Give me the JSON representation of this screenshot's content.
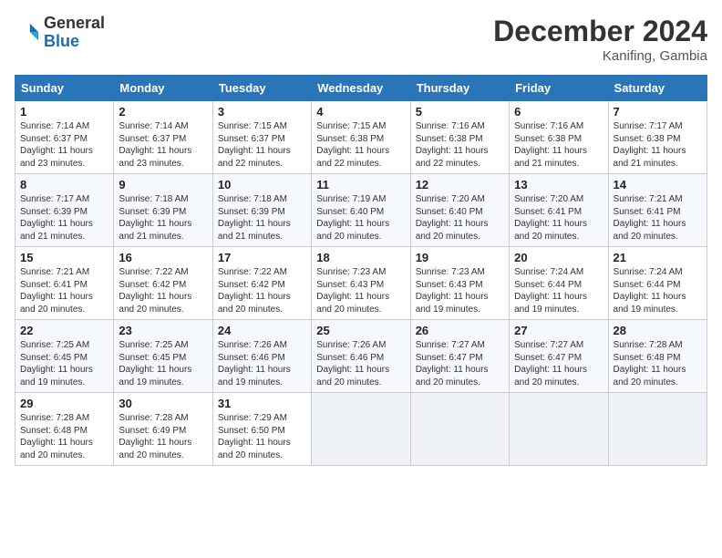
{
  "logo": {
    "general": "General",
    "blue": "Blue"
  },
  "title": "December 2024",
  "location": "Kanifing, Gambia",
  "days_of_week": [
    "Sunday",
    "Monday",
    "Tuesday",
    "Wednesday",
    "Thursday",
    "Friday",
    "Saturday"
  ],
  "weeks": [
    [
      {
        "day": 1,
        "info": "Sunrise: 7:14 AM\nSunset: 6:37 PM\nDaylight: 11 hours\nand 23 minutes."
      },
      {
        "day": 2,
        "info": "Sunrise: 7:14 AM\nSunset: 6:37 PM\nDaylight: 11 hours\nand 23 minutes."
      },
      {
        "day": 3,
        "info": "Sunrise: 7:15 AM\nSunset: 6:37 PM\nDaylight: 11 hours\nand 22 minutes."
      },
      {
        "day": 4,
        "info": "Sunrise: 7:15 AM\nSunset: 6:38 PM\nDaylight: 11 hours\nand 22 minutes."
      },
      {
        "day": 5,
        "info": "Sunrise: 7:16 AM\nSunset: 6:38 PM\nDaylight: 11 hours\nand 22 minutes."
      },
      {
        "day": 6,
        "info": "Sunrise: 7:16 AM\nSunset: 6:38 PM\nDaylight: 11 hours\nand 21 minutes."
      },
      {
        "day": 7,
        "info": "Sunrise: 7:17 AM\nSunset: 6:38 PM\nDaylight: 11 hours\nand 21 minutes."
      }
    ],
    [
      {
        "day": 8,
        "info": "Sunrise: 7:17 AM\nSunset: 6:39 PM\nDaylight: 11 hours\nand 21 minutes."
      },
      {
        "day": 9,
        "info": "Sunrise: 7:18 AM\nSunset: 6:39 PM\nDaylight: 11 hours\nand 21 minutes."
      },
      {
        "day": 10,
        "info": "Sunrise: 7:18 AM\nSunset: 6:39 PM\nDaylight: 11 hours\nand 21 minutes."
      },
      {
        "day": 11,
        "info": "Sunrise: 7:19 AM\nSunset: 6:40 PM\nDaylight: 11 hours\nand 20 minutes."
      },
      {
        "day": 12,
        "info": "Sunrise: 7:20 AM\nSunset: 6:40 PM\nDaylight: 11 hours\nand 20 minutes."
      },
      {
        "day": 13,
        "info": "Sunrise: 7:20 AM\nSunset: 6:41 PM\nDaylight: 11 hours\nand 20 minutes."
      },
      {
        "day": 14,
        "info": "Sunrise: 7:21 AM\nSunset: 6:41 PM\nDaylight: 11 hours\nand 20 minutes."
      }
    ],
    [
      {
        "day": 15,
        "info": "Sunrise: 7:21 AM\nSunset: 6:41 PM\nDaylight: 11 hours\nand 20 minutes."
      },
      {
        "day": 16,
        "info": "Sunrise: 7:22 AM\nSunset: 6:42 PM\nDaylight: 11 hours\nand 20 minutes."
      },
      {
        "day": 17,
        "info": "Sunrise: 7:22 AM\nSunset: 6:42 PM\nDaylight: 11 hours\nand 20 minutes."
      },
      {
        "day": 18,
        "info": "Sunrise: 7:23 AM\nSunset: 6:43 PM\nDaylight: 11 hours\nand 20 minutes."
      },
      {
        "day": 19,
        "info": "Sunrise: 7:23 AM\nSunset: 6:43 PM\nDaylight: 11 hours\nand 19 minutes."
      },
      {
        "day": 20,
        "info": "Sunrise: 7:24 AM\nSunset: 6:44 PM\nDaylight: 11 hours\nand 19 minutes."
      },
      {
        "day": 21,
        "info": "Sunrise: 7:24 AM\nSunset: 6:44 PM\nDaylight: 11 hours\nand 19 minutes."
      }
    ],
    [
      {
        "day": 22,
        "info": "Sunrise: 7:25 AM\nSunset: 6:45 PM\nDaylight: 11 hours\nand 19 minutes."
      },
      {
        "day": 23,
        "info": "Sunrise: 7:25 AM\nSunset: 6:45 PM\nDaylight: 11 hours\nand 19 minutes."
      },
      {
        "day": 24,
        "info": "Sunrise: 7:26 AM\nSunset: 6:46 PM\nDaylight: 11 hours\nand 19 minutes."
      },
      {
        "day": 25,
        "info": "Sunrise: 7:26 AM\nSunset: 6:46 PM\nDaylight: 11 hours\nand 20 minutes."
      },
      {
        "day": 26,
        "info": "Sunrise: 7:27 AM\nSunset: 6:47 PM\nDaylight: 11 hours\nand 20 minutes."
      },
      {
        "day": 27,
        "info": "Sunrise: 7:27 AM\nSunset: 6:47 PM\nDaylight: 11 hours\nand 20 minutes."
      },
      {
        "day": 28,
        "info": "Sunrise: 7:28 AM\nSunset: 6:48 PM\nDaylight: 11 hours\nand 20 minutes."
      }
    ],
    [
      {
        "day": 29,
        "info": "Sunrise: 7:28 AM\nSunset: 6:48 PM\nDaylight: 11 hours\nand 20 minutes."
      },
      {
        "day": 30,
        "info": "Sunrise: 7:28 AM\nSunset: 6:49 PM\nDaylight: 11 hours\nand 20 minutes."
      },
      {
        "day": 31,
        "info": "Sunrise: 7:29 AM\nSunset: 6:50 PM\nDaylight: 11 hours\nand 20 minutes."
      },
      null,
      null,
      null,
      null
    ]
  ]
}
